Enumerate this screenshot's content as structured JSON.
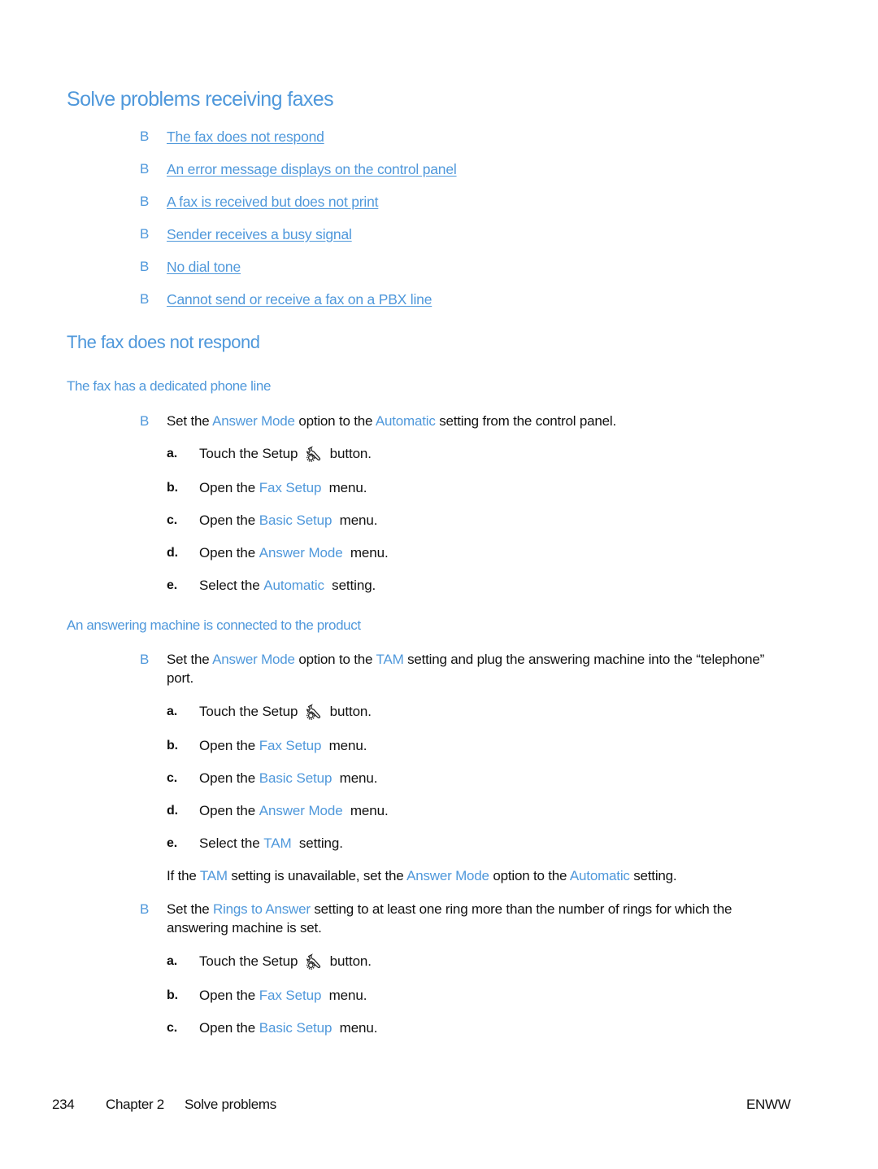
{
  "colors": {
    "accent": "#4f98db",
    "text": "#111111"
  },
  "title": "Solve problems receiving faxes",
  "toc": {
    "bullet": "B",
    "items": [
      "The fax does not respond",
      "An error message displays on the control panel",
      "A fax is received but does not print",
      "Sender receives a busy signal",
      "No dial tone",
      "Cannot send or receive a fax on a PBX line"
    ]
  },
  "section": {
    "title": "The fax does not respond",
    "sub1": {
      "title": "The fax has a dedicated phone line",
      "bullet": {
        "pre": "Set the ",
        "k1": "Answer Mode",
        "mid": " option to the ",
        "k2": "Automatic",
        "post": " setting from the control panel."
      },
      "steps": [
        {
          "label": "a.",
          "pre": "Touch the Setup ",
          "icon": "setup-wrench-gear-icon",
          "post": " button."
        },
        {
          "label": "b.",
          "pre": "Open the ",
          "key": "Fax Setup",
          "post": " menu."
        },
        {
          "label": "c.",
          "pre": "Open the ",
          "key": "Basic Setup",
          "post": " menu."
        },
        {
          "label": "d.",
          "pre": "Open the ",
          "key": "Answer Mode",
          "post": " menu."
        },
        {
          "label": "e.",
          "pre": "Select the ",
          "key": "Automatic",
          "post": " setting."
        }
      ]
    },
    "sub2": {
      "title": "An answering machine is connected to the product",
      "bullet1": {
        "pre": "Set the ",
        "k1": "Answer Mode",
        "mid": " option to the ",
        "k2": "TAM",
        "post": " setting and plug the answering machine into the “telephone” port."
      },
      "steps1": [
        {
          "label": "a.",
          "pre": "Touch the Setup ",
          "icon": "setup-wrench-gear-icon",
          "post": " button."
        },
        {
          "label": "b.",
          "pre": "Open the ",
          "key": "Fax Setup",
          "post": " menu."
        },
        {
          "label": "c.",
          "pre": "Open the ",
          "key": "Basic Setup",
          "post": " menu."
        },
        {
          "label": "d.",
          "pre": "Open the ",
          "key": "Answer Mode",
          "post": " menu."
        },
        {
          "label": "e.",
          "pre": "Select the ",
          "key": "TAM",
          "post": " setting."
        }
      ],
      "note": {
        "pre": "If the ",
        "k1": "TAM",
        "mid1": " setting is unavailable, set the ",
        "k2": "Answer Mode",
        "mid2": " option to the ",
        "k3": "Automatic",
        "post": " setting."
      },
      "bullet2": {
        "pre": "Set the ",
        "k1": "Rings to Answer",
        "post": " setting to at least one ring more than the number of rings for which the answering machine is set."
      },
      "steps2": [
        {
          "label": "a.",
          "pre": "Touch the Setup ",
          "icon": "setup-wrench-gear-icon",
          "post": " button."
        },
        {
          "label": "b.",
          "pre": "Open the ",
          "key": "Fax Setup",
          "post": " menu."
        },
        {
          "label": "c.",
          "pre": "Open the ",
          "key": "Basic Setup",
          "post": " menu."
        }
      ]
    }
  },
  "footer": {
    "page": "234",
    "chapter": "Chapter 2",
    "chapter_title": "Solve problems",
    "locale": "ENWW"
  }
}
